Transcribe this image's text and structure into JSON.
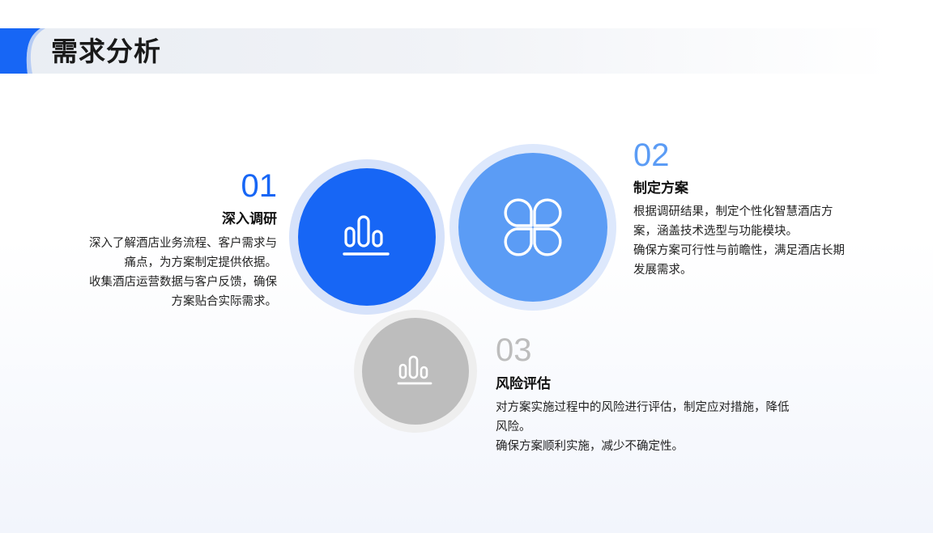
{
  "page": {
    "title": "需求分析"
  },
  "items": [
    {
      "number": "01",
      "heading": "深入调研",
      "lines": [
        "深入了解酒店业务流程、客户需求与",
        "痛点，为方案制定提供依据。",
        "收集酒店运营数据与客户反馈，确保",
        "方案贴合实际需求。"
      ],
      "icon": "bar-chart-icon",
      "color": "#1766f5"
    },
    {
      "number": "02",
      "heading": "制定方案",
      "lines": [
        "根据调研结果，制定个性化智慧酒店方",
        "案，涵盖技术选型与功能模块。",
        "确保方案可行性与前瞻性，满足酒店长期",
        "发展需求。"
      ],
      "icon": "four-petal-icon",
      "color": "#5b9cf5"
    },
    {
      "number": "03",
      "heading": "风险评估",
      "lines": [
        "对方案实施过程中的风险进行评估，制定应对措施，降低",
        "风险。",
        "确保方案顺利实施，减少不确定性。"
      ],
      "icon": "bar-chart-icon",
      "color": "#bdbdbd"
    }
  ]
}
